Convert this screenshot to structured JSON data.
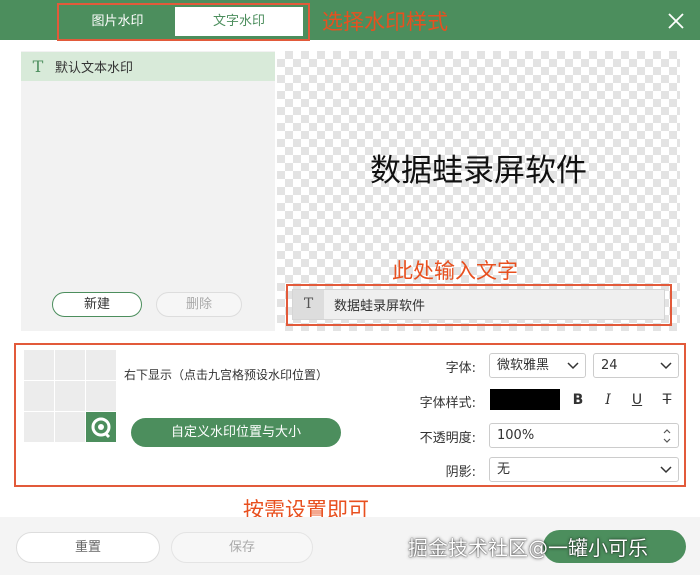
{
  "tabs": {
    "image_watermark": "图片水印",
    "text_watermark": "文字水印"
  },
  "annotations": {
    "select_style": "选择水印样式",
    "input_text": "此处输入文字",
    "set_as_needed": "按需设置即可"
  },
  "list": {
    "default_item": "默认文本水印",
    "text_icon": "T"
  },
  "buttons": {
    "new": "新建",
    "delete": "删除",
    "custom_position": "自定义水印位置与大小",
    "reset": "重置",
    "save": "保存"
  },
  "preview": {
    "watermark_text": "数据蛙录屏软件"
  },
  "text_input": {
    "value": "数据蛙录屏软件",
    "icon": "T"
  },
  "position": {
    "description": "右下显示（点击九宫格预设水印位置）",
    "selected_cell": 9
  },
  "settings": {
    "font_label": "字体:",
    "font_value": "微软雅黑",
    "size_value": "24",
    "style_label": "字体样式:",
    "color": "#000000",
    "bold": "B",
    "italic": "I",
    "underline": "U",
    "strike": "T",
    "opacity_label": "不透明度:",
    "opacity_value": "100%",
    "shadow_label": "阴影:",
    "shadow_value": "无"
  },
  "credit": "掘金技术社区@一罐小可乐",
  "colors": {
    "accent": "#4c8e5d",
    "annotation": "#e25a3a"
  }
}
